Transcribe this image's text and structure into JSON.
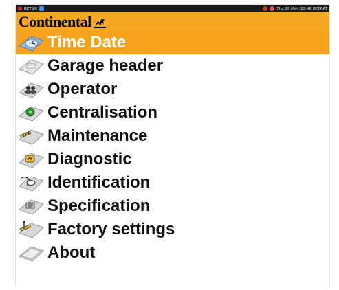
{
  "status_bar": {
    "app_name": "RETSM",
    "right_text": "Thu 29 Mar, 12:48 OPERAT"
  },
  "header": {
    "logo_text": "Continental",
    "logo_icon": "horse-icon",
    "background_color": "#f5a623"
  },
  "menu": {
    "selected_index": 0,
    "selected_color": "#f7a21c",
    "items": [
      {
        "label": "Time Date",
        "icon": "clock-icon"
      },
      {
        "label": "Garage header",
        "icon": "garage-header-icon"
      },
      {
        "label": "Operator",
        "icon": "operator-icon"
      },
      {
        "label": "Centralisation",
        "icon": "centralisation-icon"
      },
      {
        "label": "Maintenance",
        "icon": "maintenance-icon"
      },
      {
        "label": "Diagnostic",
        "icon": "diagnostic-icon"
      },
      {
        "label": "Identification",
        "icon": "identification-icon"
      },
      {
        "label": "Specification",
        "icon": "specification-icon"
      },
      {
        "label": "Factory settings",
        "icon": "factory-settings-icon"
      },
      {
        "label": "About",
        "icon": "about-icon"
      }
    ]
  }
}
